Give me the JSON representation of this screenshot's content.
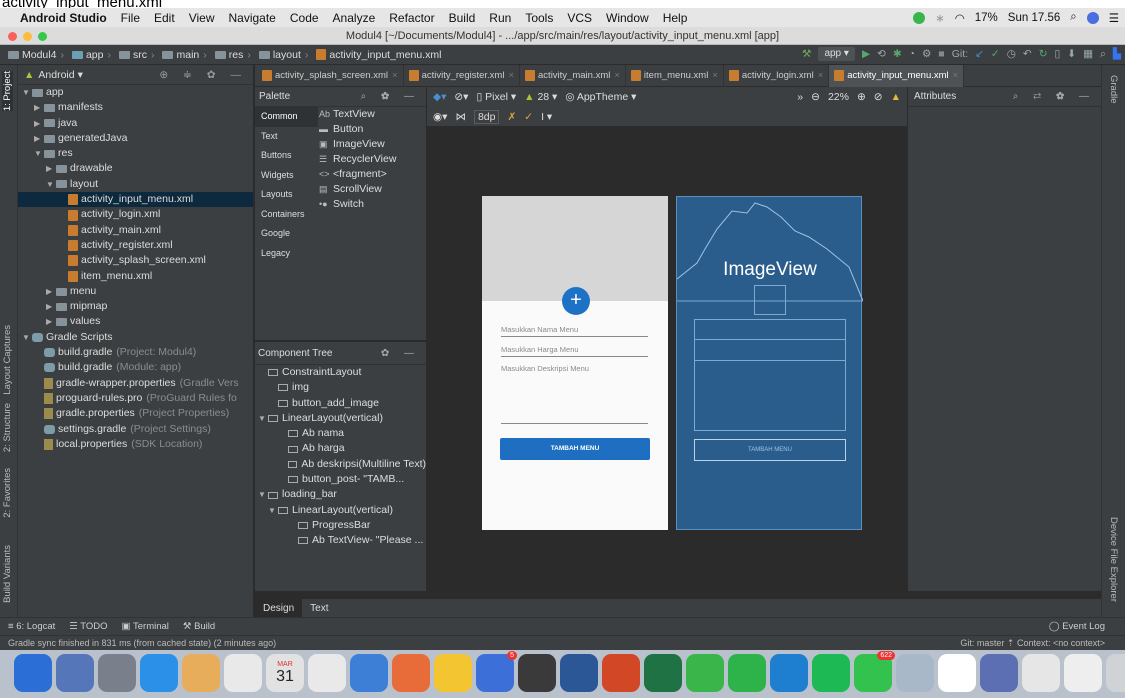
{
  "top_strip": "activity_input_menu.xml",
  "menubar": {
    "app_name": "Android Studio",
    "items": [
      "File",
      "Edit",
      "View",
      "Navigate",
      "Code",
      "Analyze",
      "Refactor",
      "Build",
      "Run",
      "Tools",
      "VCS",
      "Window",
      "Help"
    ],
    "battery": "17%",
    "clock": "Sun 17.56"
  },
  "window_title": "Modul4 [~/Documents/Modul4] - .../app/src/main/res/layout/activity_input_menu.xml [app]",
  "navbar": {
    "crumbs": [
      "Modul4",
      "app",
      "src",
      "main",
      "res",
      "layout",
      "activity_input_menu.xml"
    ],
    "run_config": "app",
    "git_label": "Git:"
  },
  "project_panel": {
    "title": "Android",
    "rows": [
      {
        "label": "app",
        "indent": 0,
        "arrow": "▼",
        "type": "folder"
      },
      {
        "label": "manifests",
        "indent": 1,
        "arrow": "▶",
        "type": "folder"
      },
      {
        "label": "java",
        "indent": 1,
        "arrow": "▶",
        "type": "folder"
      },
      {
        "label": "generatedJava",
        "indent": 1,
        "arrow": "▶",
        "type": "folder"
      },
      {
        "label": "res",
        "indent": 1,
        "arrow": "▼",
        "type": "folder"
      },
      {
        "label": "drawable",
        "indent": 2,
        "arrow": "▶",
        "type": "folder"
      },
      {
        "label": "layout",
        "indent": 2,
        "arrow": "▼",
        "type": "folder"
      },
      {
        "label": "activity_input_menu.xml",
        "indent": 3,
        "arrow": "",
        "type": "xml",
        "selected": true
      },
      {
        "label": "activity_login.xml",
        "indent": 3,
        "arrow": "",
        "type": "xml"
      },
      {
        "label": "activity_main.xml",
        "indent": 3,
        "arrow": "",
        "type": "xml"
      },
      {
        "label": "activity_register.xml",
        "indent": 3,
        "arrow": "",
        "type": "xml"
      },
      {
        "label": "activity_splash_screen.xml",
        "indent": 3,
        "arrow": "",
        "type": "xml"
      },
      {
        "label": "item_menu.xml",
        "indent": 3,
        "arrow": "",
        "type": "xml"
      },
      {
        "label": "menu",
        "indent": 2,
        "arrow": "▶",
        "type": "folder"
      },
      {
        "label": "mipmap",
        "indent": 2,
        "arrow": "▶",
        "type": "folder"
      },
      {
        "label": "values",
        "indent": 2,
        "arrow": "▶",
        "type": "folder"
      },
      {
        "label": "Gradle Scripts",
        "indent": 0,
        "arrow": "▼",
        "type": "gradle"
      },
      {
        "label": "build.gradle",
        "note": "(Project: Modul4)",
        "indent": 1,
        "arrow": "",
        "type": "gradle"
      },
      {
        "label": "build.gradle",
        "note": "(Module: app)",
        "indent": 1,
        "arrow": "",
        "type": "gradle"
      },
      {
        "label": "gradle-wrapper.properties",
        "note": "(Gradle Vers",
        "indent": 1,
        "arrow": "",
        "type": "prop"
      },
      {
        "label": "proguard-rules.pro",
        "note": "(ProGuard Rules fo",
        "indent": 1,
        "arrow": "",
        "type": "prop"
      },
      {
        "label": "gradle.properties",
        "note": "(Project Properties)",
        "indent": 1,
        "arrow": "",
        "type": "prop"
      },
      {
        "label": "settings.gradle",
        "note": "(Project Settings)",
        "indent": 1,
        "arrow": "",
        "type": "gradle"
      },
      {
        "label": "local.properties",
        "note": "(SDK Location)",
        "indent": 1,
        "arrow": "",
        "type": "prop"
      }
    ]
  },
  "left_stripe": [
    "1: Project",
    "Layout Captures",
    "2: Structure",
    "2: Favorites",
    "Build Variants"
  ],
  "right_stripe": [
    "Gradle",
    "Device File Explorer"
  ],
  "editor_tabs": [
    "activity_splash_screen.xml",
    "activity_register.xml",
    "activity_main.xml",
    "item_menu.xml",
    "activity_login.xml",
    "activity_input_menu.xml"
  ],
  "palette": {
    "title": "Palette",
    "categories": [
      "Common",
      "Text",
      "Buttons",
      "Widgets",
      "Layouts",
      "Containers",
      "Google",
      "Legacy"
    ],
    "items": [
      {
        "icon": "Ab",
        "label": "TextView"
      },
      {
        "icon": "▬",
        "label": "Button"
      },
      {
        "icon": "▣",
        "label": "ImageView"
      },
      {
        "icon": "☰",
        "label": "RecyclerView"
      },
      {
        "icon": "<>",
        "label": "<fragment>"
      },
      {
        "icon": "▤",
        "label": "ScrollView"
      },
      {
        "icon": "•●",
        "label": "Switch"
      }
    ]
  },
  "component_tree": {
    "title": "Component Tree",
    "rows": [
      {
        "label": "ConstraintLayout",
        "indent": 0,
        "arrow": ""
      },
      {
        "label": "img",
        "indent": 1,
        "arrow": ""
      },
      {
        "label": "button_add_image",
        "indent": 1,
        "arrow": ""
      },
      {
        "label": "LinearLayout(vertical)",
        "indent": 0,
        "arrow": "▼"
      },
      {
        "label": "Ab nama",
        "indent": 2,
        "arrow": ""
      },
      {
        "label": "Ab harga",
        "indent": 2,
        "arrow": ""
      },
      {
        "label": "Ab deskripsi(Multiline Text)",
        "indent": 2,
        "arrow": ""
      },
      {
        "label": "button_post- \"TAMB...",
        "indent": 2,
        "arrow": ""
      },
      {
        "label": "loading_bar",
        "indent": 0,
        "arrow": "▼"
      },
      {
        "label": "LinearLayout(vertical)",
        "indent": 1,
        "arrow": "▼"
      },
      {
        "label": "ProgressBar",
        "indent": 3,
        "arrow": ""
      },
      {
        "label": "Ab TextView- \"Please ...",
        "indent": 3,
        "arrow": ""
      }
    ]
  },
  "design_toolbar": {
    "device": "Pixel",
    "api": "28",
    "theme": "AppTheme",
    "zoom": "22%",
    "margin": "8dp"
  },
  "attributes": {
    "title": "Attributes"
  },
  "design_preview": {
    "field1": "Masukkan Nama Menu",
    "field2": "Masukkan Harga Menu",
    "field3": "Masukkan Deskripsi Menu",
    "button": "TAMBAH MENU"
  },
  "blueprint": {
    "image_label": "ImageView",
    "button": "TAMBAH MENU"
  },
  "bottom_tabs": [
    "Design",
    "Text"
  ],
  "tool_windows": [
    "6: Logcat",
    "TODO",
    "Terminal",
    "Build"
  ],
  "event_log": "Event Log",
  "status": {
    "message": "Gradle sync finished in 831 ms (from cached state) (2 minutes ago)",
    "right": "Git: master ⇡ Context: <no context>"
  },
  "dock": {
    "calendar_month": "MAR",
    "calendar_day": "31",
    "badge_mail": "5",
    "badge_line": "622",
    "colors": [
      "#2b6fd6",
      "#5576b8",
      "#7a7f8c",
      "#2b91e8",
      "#e7ad5a",
      "#e9e9e9",
      "#e2e2e2",
      "#e9e9e9",
      "#3d7fd6",
      "#e86b3a",
      "#f3c530",
      "#3d6fd9",
      "#3a3a3a",
      "#2b5797",
      "#d24726",
      "#1f7244",
      "#3ab54a",
      "#2db34a",
      "#1e7ed0",
      "#1db954",
      "#33c24d",
      "#a9b8c8",
      "#ffffff",
      "#5c6fb3",
      "#e6e6e6",
      "#eeeeee",
      "#cfd3d6"
    ]
  }
}
